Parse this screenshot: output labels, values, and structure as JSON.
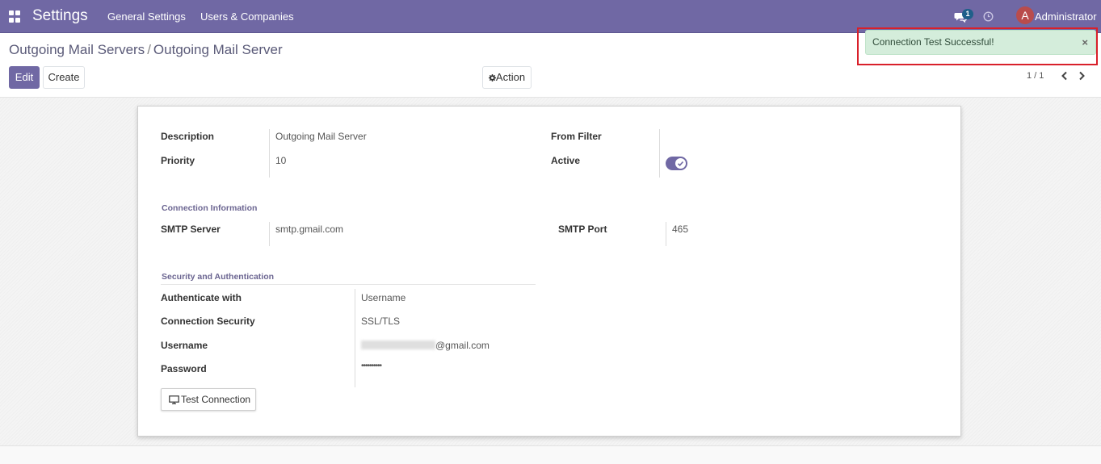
{
  "navbar": {
    "brand": "Settings",
    "menu": [
      "General Settings",
      "Users & Companies"
    ],
    "chat_badge": "1",
    "avatar_letter": "A",
    "user_name": "Administrator"
  },
  "breadcrumb": {
    "parent": "Outgoing Mail Servers",
    "separator": "/",
    "current": "Outgoing Mail Server"
  },
  "toolbar": {
    "edit_label": "Edit",
    "create_label": "Create",
    "action_label": "Action"
  },
  "pager": {
    "value": "1 / 1"
  },
  "toast": {
    "message": "Connection Test Successful!",
    "close": "×"
  },
  "form": {
    "description": {
      "label": "Description",
      "value": "Outgoing Mail Server"
    },
    "priority": {
      "label": "Priority",
      "value": "10"
    },
    "from_filter": {
      "label": "From Filter",
      "value": ""
    },
    "active": {
      "label": "Active",
      "value": true
    },
    "connection_title": "Connection Information",
    "smtp_server": {
      "label": "SMTP Server",
      "value": "smtp.gmail.com"
    },
    "smtp_port": {
      "label": "SMTP Port",
      "value": "465"
    },
    "security_title": "Security and Authentication",
    "authenticate_with": {
      "label": "Authenticate with",
      "value": "Username"
    },
    "connection_security": {
      "label": "Connection Security",
      "value": "SSL/TLS"
    },
    "username": {
      "label": "Username",
      "value_suffix": "@gmail.com"
    },
    "password": {
      "label": "Password",
      "value": "••••••••••"
    },
    "test_button": "Test Connection"
  },
  "colors": {
    "navbar": "#7068a4",
    "toast_bg": "#d4eddb",
    "toast_outline": "#d9202a"
  }
}
